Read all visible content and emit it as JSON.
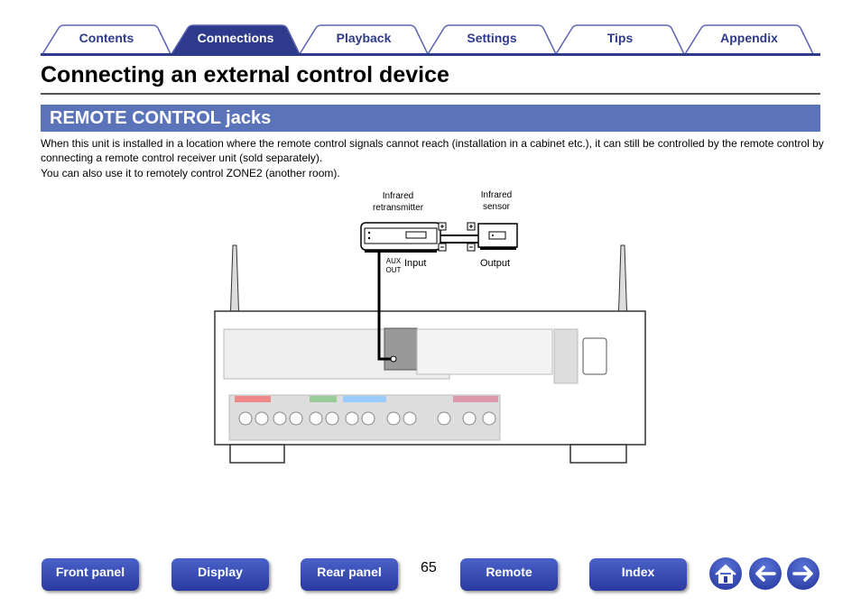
{
  "tabs": [
    {
      "label": "Contents",
      "active": false
    },
    {
      "label": "Connections",
      "active": true
    },
    {
      "label": "Playback",
      "active": false
    },
    {
      "label": "Settings",
      "active": false
    },
    {
      "label": "Tips",
      "active": false
    },
    {
      "label": "Appendix",
      "active": false
    }
  ],
  "page_title": "Connecting an external control device",
  "section_title": "REMOTE CONTROL jacks",
  "paragraphs": [
    "When this unit is installed in a location where the remote control signals cannot reach (installation in a cabinet etc.), it can still be controlled by the remote control by connecting a remote control receiver unit (sold separately).",
    "You can also use it to remotely control ZONE2 (another room)."
  ],
  "diagram": {
    "retransmitter": "Infrared retransmitter",
    "sensor": "Infrared sensor",
    "aux_out": "AUX OUT",
    "input": "Input",
    "output": "Output",
    "plus": "+",
    "minus": "−"
  },
  "footer": {
    "buttons": [
      "Front panel",
      "Display",
      "Rear panel",
      "Remote",
      "Index"
    ],
    "page_number": "65",
    "icons": [
      "home-icon",
      "arrow-left-icon",
      "arrow-right-icon"
    ]
  },
  "colors": {
    "accent": "#2e3a8c",
    "section_bar": "#5b73b8"
  }
}
